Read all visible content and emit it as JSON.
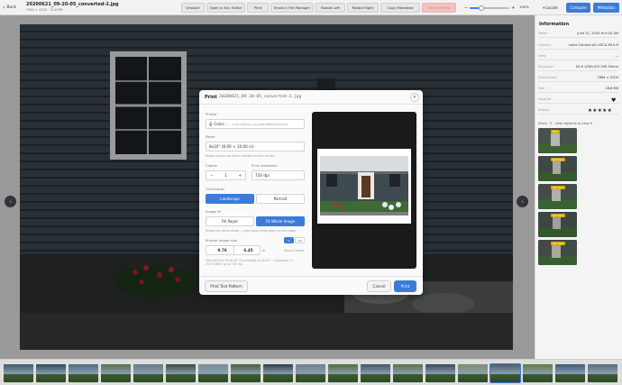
{
  "toolbar": {
    "back": "Back",
    "filename": "20200621_09-20-05_converted-2.jpg",
    "filemeta": "7864 × 5200 · 18.8 MB",
    "buttons": [
      "Unstack",
      "Open in Ext. Editor",
      "Print",
      "Show in File Manager",
      "Rotate Left",
      "Rotate Right",
      "Copy Metadata",
      "Delete Photo"
    ],
    "zoom_value": 0.3,
    "zoom_label": "100%",
    "locate": "Locate",
    "compare": "Compare",
    "metadata": "Metadata"
  },
  "info": {
    "title": "Information",
    "rows": [
      {
        "k": "Taken",
        "v": "June 21, 2020 at 9:20 AM"
      },
      {
        "k": "Camera",
        "v": "Leica Camera AG LEICA M10-R"
      },
      {
        "k": "Lens",
        "v": "—"
      },
      {
        "k": "Exposure",
        "v": "f/5.6 1/90s ISO 200 50mm"
      },
      {
        "k": "Dimensions",
        "v": "7864 × 5200"
      },
      {
        "k": "Size",
        "v": "18.8 MB"
      },
      {
        "k": "Favorite",
        "v": ""
      },
      {
        "k": "Rating",
        "v": ""
      }
    ],
    "stars": "★★★★★",
    "heart": "♥",
    "similar": "Stack · 5 - slide vigilants to view it",
    "similar_badges": [
      "Pick",
      "Set Pick",
      "Set Pick",
      "Set Pick",
      "Set Pick"
    ]
  },
  "dialog": {
    "title": "Print",
    "filename": "20200621_09-20-05_converted-2.jpg",
    "close": "×",
    "printer_label": "Printer",
    "printer_name": "Color-...",
    "printer_model": "EcoPrint Epson_StylusPro3880 TurboPrint",
    "paper_label": "Paper",
    "paper_value": "8x10\" (8.00 × 10.00 in)",
    "paper_hint": "Papers shown are those installed for this printer.",
    "copies_label": "Copies",
    "copies_value": "1",
    "minus": "−",
    "plus": "+",
    "resolution_label": "Print resolution",
    "resolution_value": "720 dpi",
    "orientation_label": "Orientation",
    "landscape": "Landscape",
    "portrait": "Portrait",
    "fit_label": "Image fit",
    "fill_paper": "Fill Paper",
    "fit_whole": "Fit Whole Image",
    "fit_hint": "Shows the whole photo — may leave white space on one edge.",
    "size_label": "Printed image size",
    "unit_in": "in",
    "unit_cm": "cm",
    "width_value": "9.76",
    "times": "×",
    "height_value": "6.45",
    "unit_suffix": "in",
    "aspect": "Aspect locked",
    "size_hint": "This will fit 9.76×6.45\" (is printable on 8x10\" - Landscape -> 7027×4647 px at 720 dpi",
    "print_test": "Print Test Pattern",
    "cancel": "Cancel",
    "print": "Print"
  }
}
